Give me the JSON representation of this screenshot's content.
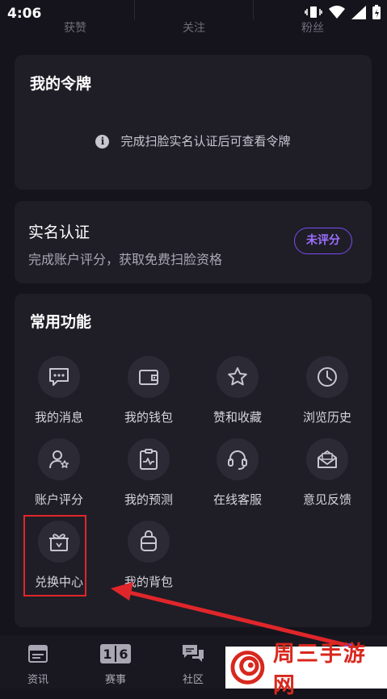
{
  "status_bar": {
    "time": "4:06"
  },
  "stats": {
    "likes_label": "获赞",
    "following_label": "关注",
    "fans_label": "粉丝"
  },
  "token_card": {
    "title": "我的令牌",
    "info": "完成扫脸实名认证后可查看令牌"
  },
  "verify_card": {
    "title": "实名认证",
    "subtitle": "完成账户评分，获取免费扫脸资格",
    "badge": "未评分"
  },
  "features": {
    "title": "常用功能",
    "items": [
      {
        "label": "我的消息",
        "icon": "message-icon"
      },
      {
        "label": "我的钱包",
        "icon": "wallet-icon"
      },
      {
        "label": "赞和收藏",
        "icon": "star-icon"
      },
      {
        "label": "浏览历史",
        "icon": "clock-icon"
      },
      {
        "label": "账户评分",
        "icon": "user-star-icon"
      },
      {
        "label": "我的预测",
        "icon": "clipboard-chart-icon"
      },
      {
        "label": "在线客服",
        "icon": "headset-icon"
      },
      {
        "label": "意见反馈",
        "icon": "feedback-mail-icon"
      },
      {
        "label": "兑换中心",
        "icon": "gift-icon"
      },
      {
        "label": "我的背包",
        "icon": "backpack-icon"
      }
    ]
  },
  "bottom_nav": {
    "items": [
      {
        "label": "资讯",
        "icon": "news-icon"
      },
      {
        "label": "赛事",
        "icon": "scoreboard-icon",
        "icon_text": "16"
      },
      {
        "label": "社区",
        "icon": "chat-icon"
      }
    ]
  },
  "watermark": {
    "text": "周三手游网"
  },
  "colors": {
    "background": "#15141c",
    "card": "#1f1e27",
    "accent": "#7a4cf0",
    "highlight": "#e0262a"
  }
}
